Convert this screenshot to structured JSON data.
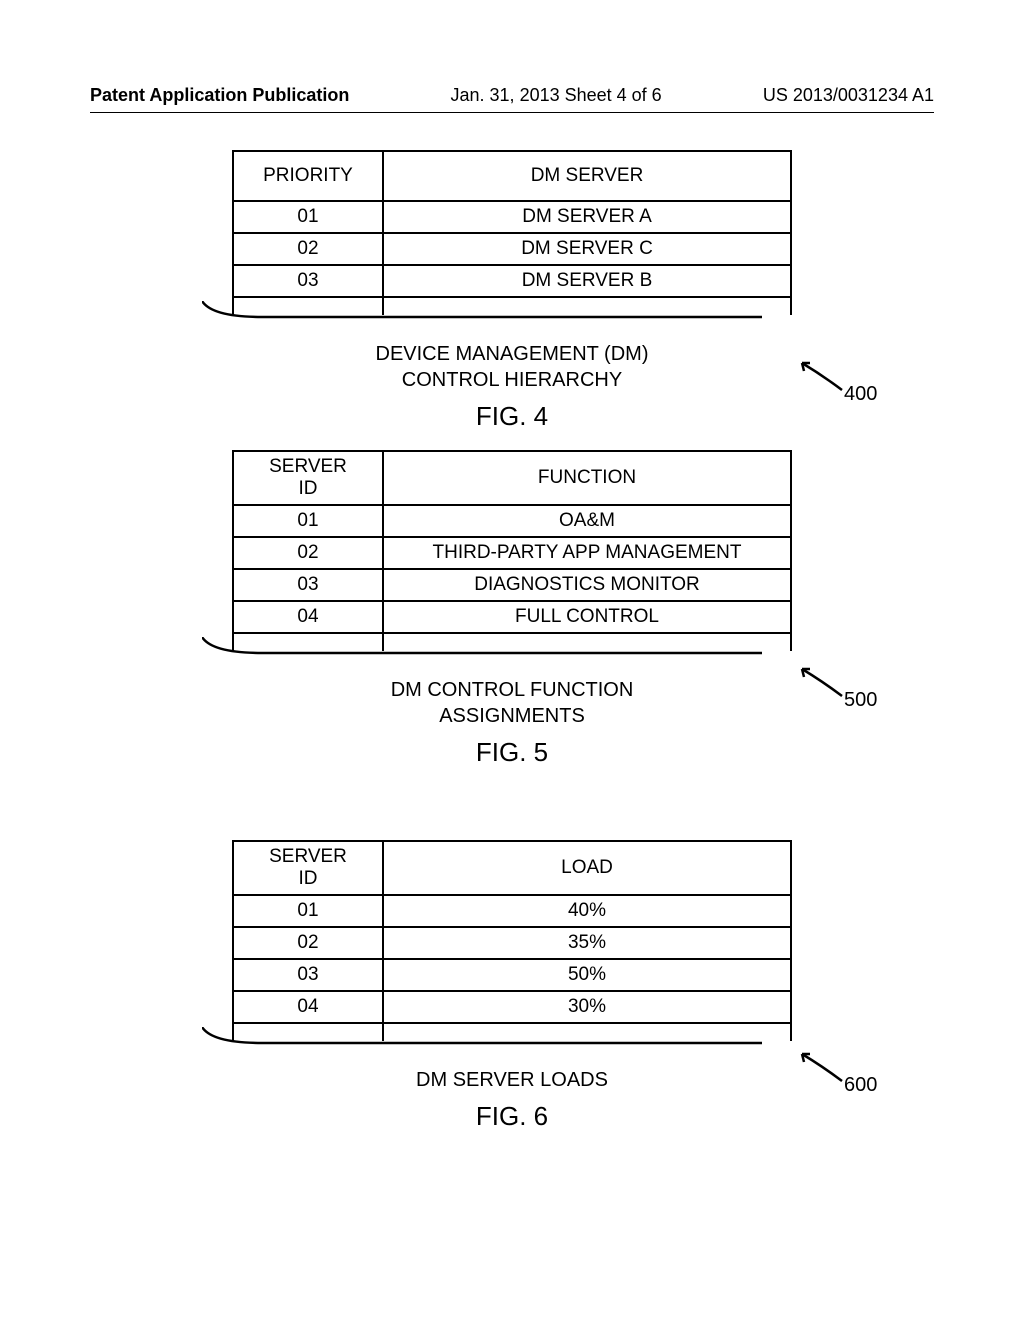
{
  "header": {
    "left": "Patent Application Publication",
    "center": "Jan. 31, 2013  Sheet 4 of 6",
    "right": "US 2013/0031234 A1"
  },
  "fig4": {
    "headers": [
      "PRIORITY",
      "DM SERVER"
    ],
    "rows": [
      [
        "01",
        "DM SERVER A"
      ],
      [
        "02",
        "DM SERVER C"
      ],
      [
        "03",
        "DM SERVER B"
      ]
    ],
    "caption_line1": "DEVICE MANAGEMENT (DM)",
    "caption_line2": "CONTROL HIERARCHY",
    "label": "FIG. 4",
    "ref": "400"
  },
  "fig5": {
    "headers": [
      "SERVER ID",
      "FUNCTION"
    ],
    "rows": [
      [
        "01",
        "OA&M"
      ],
      [
        "02",
        "THIRD-PARTY APP MANAGEMENT"
      ],
      [
        "03",
        "DIAGNOSTICS MONITOR"
      ],
      [
        "04",
        "FULL CONTROL"
      ]
    ],
    "caption_line1": "DM CONTROL FUNCTION",
    "caption_line2": "ASSIGNMENTS",
    "label": "FIG. 5",
    "ref": "500"
  },
  "fig6": {
    "headers": [
      "SERVER ID",
      "LOAD"
    ],
    "rows": [
      [
        "01",
        "40%"
      ],
      [
        "02",
        "35%"
      ],
      [
        "03",
        "50%"
      ],
      [
        "04",
        "30%"
      ]
    ],
    "caption_line1": "DM SERVER LOADS",
    "label": "FIG. 6",
    "ref": "600"
  }
}
